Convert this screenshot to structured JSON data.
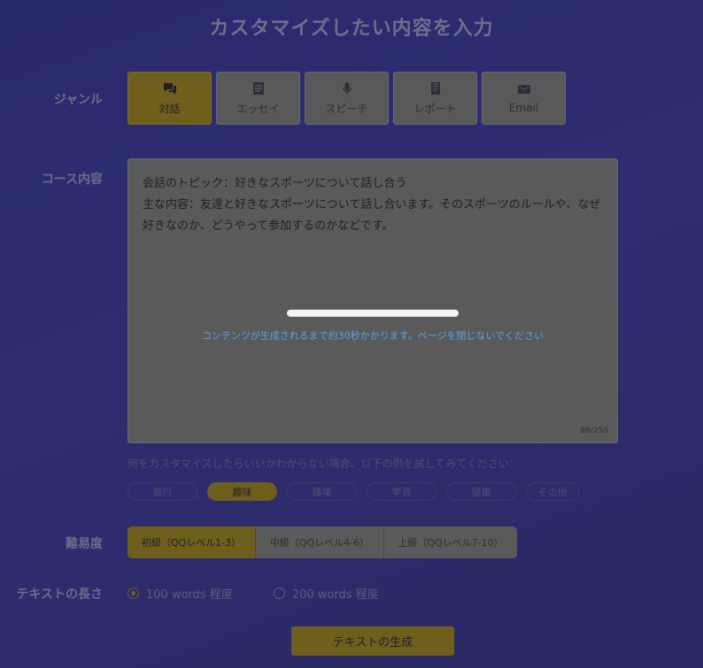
{
  "title": "カスタマイズしたい内容を入力",
  "labels": {
    "genre": "ジャンル",
    "course": "コース内容",
    "difficulty": "難易度",
    "length": "テキストの長さ"
  },
  "genres": [
    {
      "label": "対話",
      "icon": "chat-icon",
      "active": true
    },
    {
      "label": "エッセイ",
      "icon": "document-icon",
      "active": false
    },
    {
      "label": "スピーチ",
      "icon": "microphone-icon",
      "active": false
    },
    {
      "label": "レポート",
      "icon": "report-icon",
      "active": false
    },
    {
      "label": "Email",
      "icon": "mail-icon",
      "active": false
    }
  ],
  "course": {
    "text": "会話のトピック：好きなスポーツについて話し合う\n主な内容：友達と好きなスポーツについて話し合います。そのスポーツのルールや、なぜ好きなのか、どうやって参加するのかなどです。",
    "loading_message": "コンテンツが生成されるまで約30秒かかります。ページを閉じないでください",
    "counter": "86/250"
  },
  "hint": "何をカスタマイズしたらいいかわからない場合、以下の例を試してみてください：",
  "chips": [
    {
      "label": "旅行",
      "active": false
    },
    {
      "label": "趣味",
      "active": true
    },
    {
      "label": "職場",
      "active": false
    },
    {
      "label": "学習",
      "active": false
    },
    {
      "label": "健康",
      "active": false
    },
    {
      "label": "その他",
      "active": false
    }
  ],
  "difficulty": [
    {
      "label": "初級（QQレベル1-3）",
      "active": true
    },
    {
      "label": "中級（QQレベル4-6）",
      "active": false
    },
    {
      "label": "上級（QQレベル7-10）",
      "active": false
    }
  ],
  "length": [
    {
      "label": "100 words 程度",
      "checked": true
    },
    {
      "label": "200 words 程度",
      "checked": false
    }
  ],
  "generate_label": "テキストの生成",
  "colors": {
    "accent": "#6e5f1c",
    "loading_text": "#5aa0e8"
  }
}
